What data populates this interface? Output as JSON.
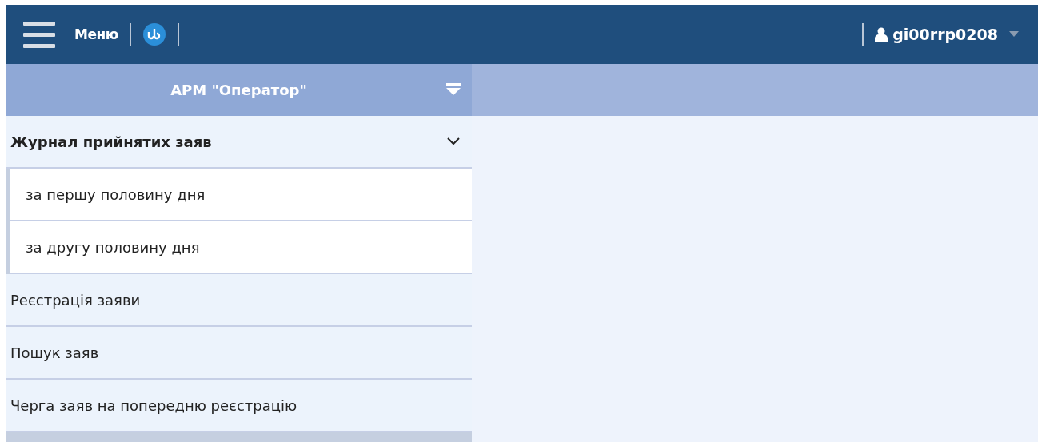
{
  "header": {
    "menu_label": "Меню",
    "user": "gi00rrp0208"
  },
  "sidebar": {
    "title": "АРМ \"Оператор\"",
    "items": [
      {
        "label": "Журнал прийнятих заяв",
        "expanded": true,
        "children": [
          {
            "label": "за першу половину дня"
          },
          {
            "label": "за другу половину дня"
          }
        ]
      },
      {
        "label": "Реєстрація заяви"
      },
      {
        "label": "Пошук заяв"
      },
      {
        "label": "Черга заяв на попередню реєстрацію"
      }
    ]
  }
}
